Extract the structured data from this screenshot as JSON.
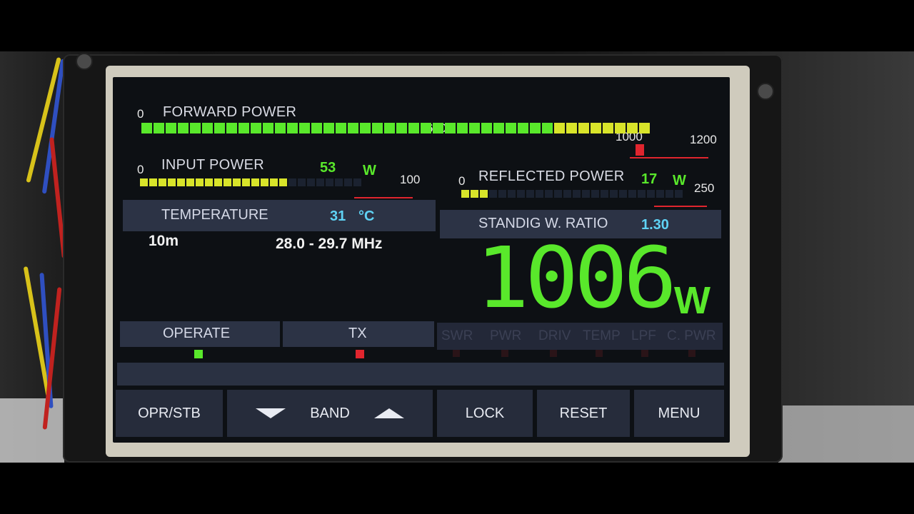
{
  "forward_power": {
    "label": "FORWARD POWER",
    "scale": [
      "0",
      "600",
      "1000",
      "1200"
    ],
    "value_w": 1006
  },
  "input_power": {
    "label": "INPUT POWER",
    "value": "53",
    "unit": "W",
    "scale": [
      "0",
      "100"
    ]
  },
  "reflected_power": {
    "label": "REFLECTED POWER",
    "value": "17",
    "unit": "W",
    "scale": [
      "0",
      "250"
    ]
  },
  "temperature": {
    "label": "TEMPERATURE",
    "value": "31",
    "unit": "°C"
  },
  "swr": {
    "label": "STANDIG W. RATIO",
    "value": "1.30"
  },
  "band": {
    "name": "10m",
    "range": "28.0 - 29.7 MHz"
  },
  "power_display": {
    "value": "1006",
    "unit": "W"
  },
  "status": {
    "operate": "OPERATE",
    "tx": "TX",
    "faults": [
      "SWR",
      "PWR",
      "DRIV",
      "TEMP",
      "LPF",
      "C. PWR"
    ]
  },
  "buttons": {
    "opr_stb": "OPR/STB",
    "band": "BAND",
    "lock": "LOCK",
    "reset": "RESET",
    "menu": "MENU"
  },
  "colors": {
    "green": "#59e82b",
    "yellow": "#d8e42a",
    "red": "#e0252e",
    "cyan": "#5fd3f5"
  }
}
